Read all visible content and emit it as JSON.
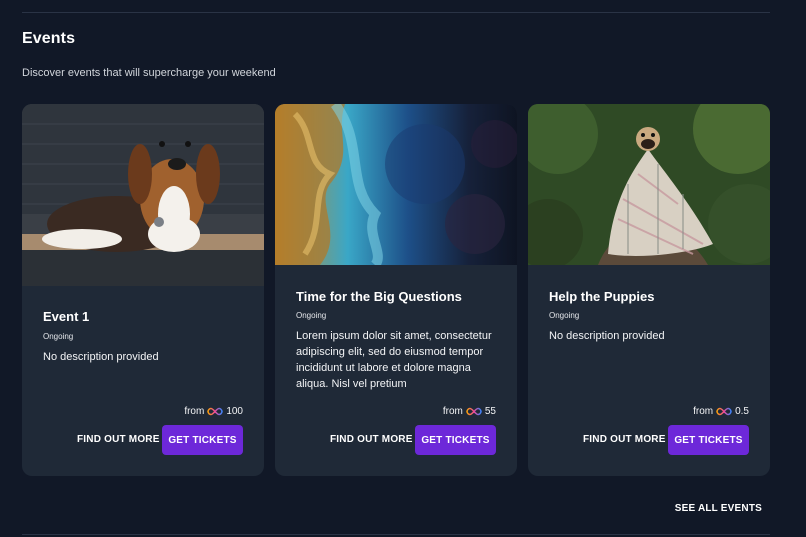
{
  "section": {
    "title": "Events",
    "subtitle": "Discover events that will supercharge your weekend"
  },
  "events": [
    {
      "title": "Event 1",
      "status": "Ongoing",
      "description": "No description provided",
      "price_prefix": "from",
      "price": "100",
      "currency_icon": "infinity-icon",
      "find_out_more": "FIND OUT MORE",
      "get_tickets": "GET TICKETS",
      "image": "beagle-dog-photo"
    },
    {
      "title": "Time for the Big Questions",
      "status": "Ongoing",
      "description": "Lorem ipsum dolor sit amet, consectetur adipiscing elit, sed do eiusmod tempor incididunt ut labore et dolore magna aliqua. Nisl vel pretium",
      "price_prefix": "from",
      "price": "55",
      "currency_icon": "infinity-icon",
      "find_out_more": "FIND OUT MORE",
      "get_tickets": "GET TICKETS",
      "image": "aerial-earth-photo"
    },
    {
      "title": "Help the Puppies",
      "status": "Ongoing",
      "description": "No description provided",
      "price_prefix": "from",
      "price": "0.5",
      "currency_icon": "infinity-icon",
      "find_out_more": "FIND OUT MORE",
      "get_tickets": "GET TICKETS",
      "image": "pug-in-blanket-photo"
    }
  ],
  "footer": {
    "see_all": "SEE ALL EVENTS"
  },
  "colors": {
    "background": "#111827",
    "card": "#1f2937",
    "accent": "#6d28d9"
  }
}
